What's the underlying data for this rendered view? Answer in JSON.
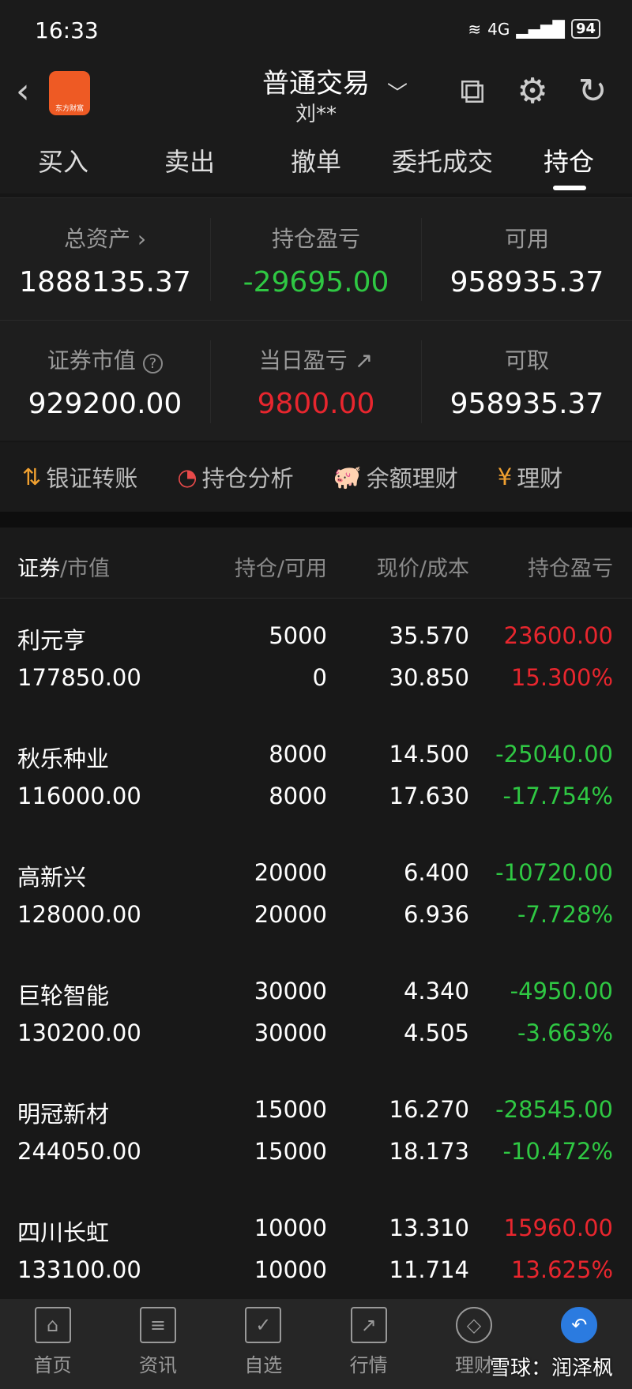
{
  "status_bar": {
    "time": "16:33",
    "network": "4G",
    "battery": "94"
  },
  "header": {
    "title": "普通交易",
    "account": "刘**",
    "logo_text": "东方财富"
  },
  "tabs": [
    {
      "label": "买入"
    },
    {
      "label": "卖出"
    },
    {
      "label": "撤单"
    },
    {
      "label": "委托成交"
    },
    {
      "label": "持仓",
      "active": true
    }
  ],
  "summary": [
    {
      "label": "总资产",
      "value": "1888135.37",
      "suffix": "›"
    },
    {
      "label": "持仓盈亏",
      "value": "-29695.00",
      "color": "green"
    },
    {
      "label": "可用",
      "value": "958935.37"
    },
    {
      "label": "证券市值",
      "value": "929200.00",
      "suffix": "?"
    },
    {
      "label": "当日盈亏",
      "value": "9800.00",
      "color": "red"
    },
    {
      "label": "可取",
      "value": "958935.37"
    }
  ],
  "actions": [
    {
      "label": "银证转账",
      "icon": "transfer-icon"
    },
    {
      "label": "持仓分析",
      "icon": "pie-chart-icon"
    },
    {
      "label": "余额理财",
      "icon": "piggy-bank-icon"
    },
    {
      "label": "理财",
      "icon": "money-bag-icon"
    }
  ],
  "table": {
    "headers": {
      "security": "证券",
      "market_value": "/市值",
      "position": "持仓/可用",
      "price": "现价/成本",
      "pnl": "持仓盈亏"
    },
    "rows": [
      {
        "name": "利元亨",
        "mv": "177850.00",
        "hold": "5000",
        "avail": "0",
        "price": "35.570",
        "cost": "30.850",
        "pnl": "23600.00",
        "pct": "15.300%",
        "trend": "red"
      },
      {
        "name": "秋乐种业",
        "mv": "116000.00",
        "hold": "8000",
        "avail": "8000",
        "price": "14.500",
        "cost": "17.630",
        "pnl": "-25040.00",
        "pct": "-17.754%",
        "trend": "green"
      },
      {
        "name": "高新兴",
        "mv": "128000.00",
        "hold": "20000",
        "avail": "20000",
        "price": "6.400",
        "cost": "6.936",
        "pnl": "-10720.00",
        "pct": "-7.728%",
        "trend": "green"
      },
      {
        "name": "巨轮智能",
        "mv": "130200.00",
        "hold": "30000",
        "avail": "30000",
        "price": "4.340",
        "cost": "4.505",
        "pnl": "-4950.00",
        "pct": "-3.663%",
        "trend": "green"
      },
      {
        "name": "明冠新材",
        "mv": "244050.00",
        "hold": "15000",
        "avail": "15000",
        "price": "16.270",
        "cost": "18.173",
        "pnl": "-28545.00",
        "pct": "-10.472%",
        "trend": "green"
      },
      {
        "name": "四川长虹",
        "mv": "133100.00",
        "hold": "10000",
        "avail": "10000",
        "price": "13.310",
        "cost": "11.714",
        "pnl": "15960.00",
        "pct": "13.625%",
        "trend": "red"
      }
    ]
  },
  "bottom_nav": [
    {
      "label": "首页",
      "icon": "home-icon"
    },
    {
      "label": "资讯",
      "icon": "news-icon"
    },
    {
      "label": "自选",
      "icon": "watchlist-icon"
    },
    {
      "label": "行情",
      "icon": "market-icon"
    },
    {
      "label": "理财",
      "icon": "diamond-icon"
    },
    {
      "label": "",
      "icon": "trade-icon",
      "active": true
    }
  ],
  "watermark": "雪球：润泽枫",
  "colors": {
    "red": "#e8262e",
    "green": "#2fc843",
    "accent": "#2b7be0"
  }
}
